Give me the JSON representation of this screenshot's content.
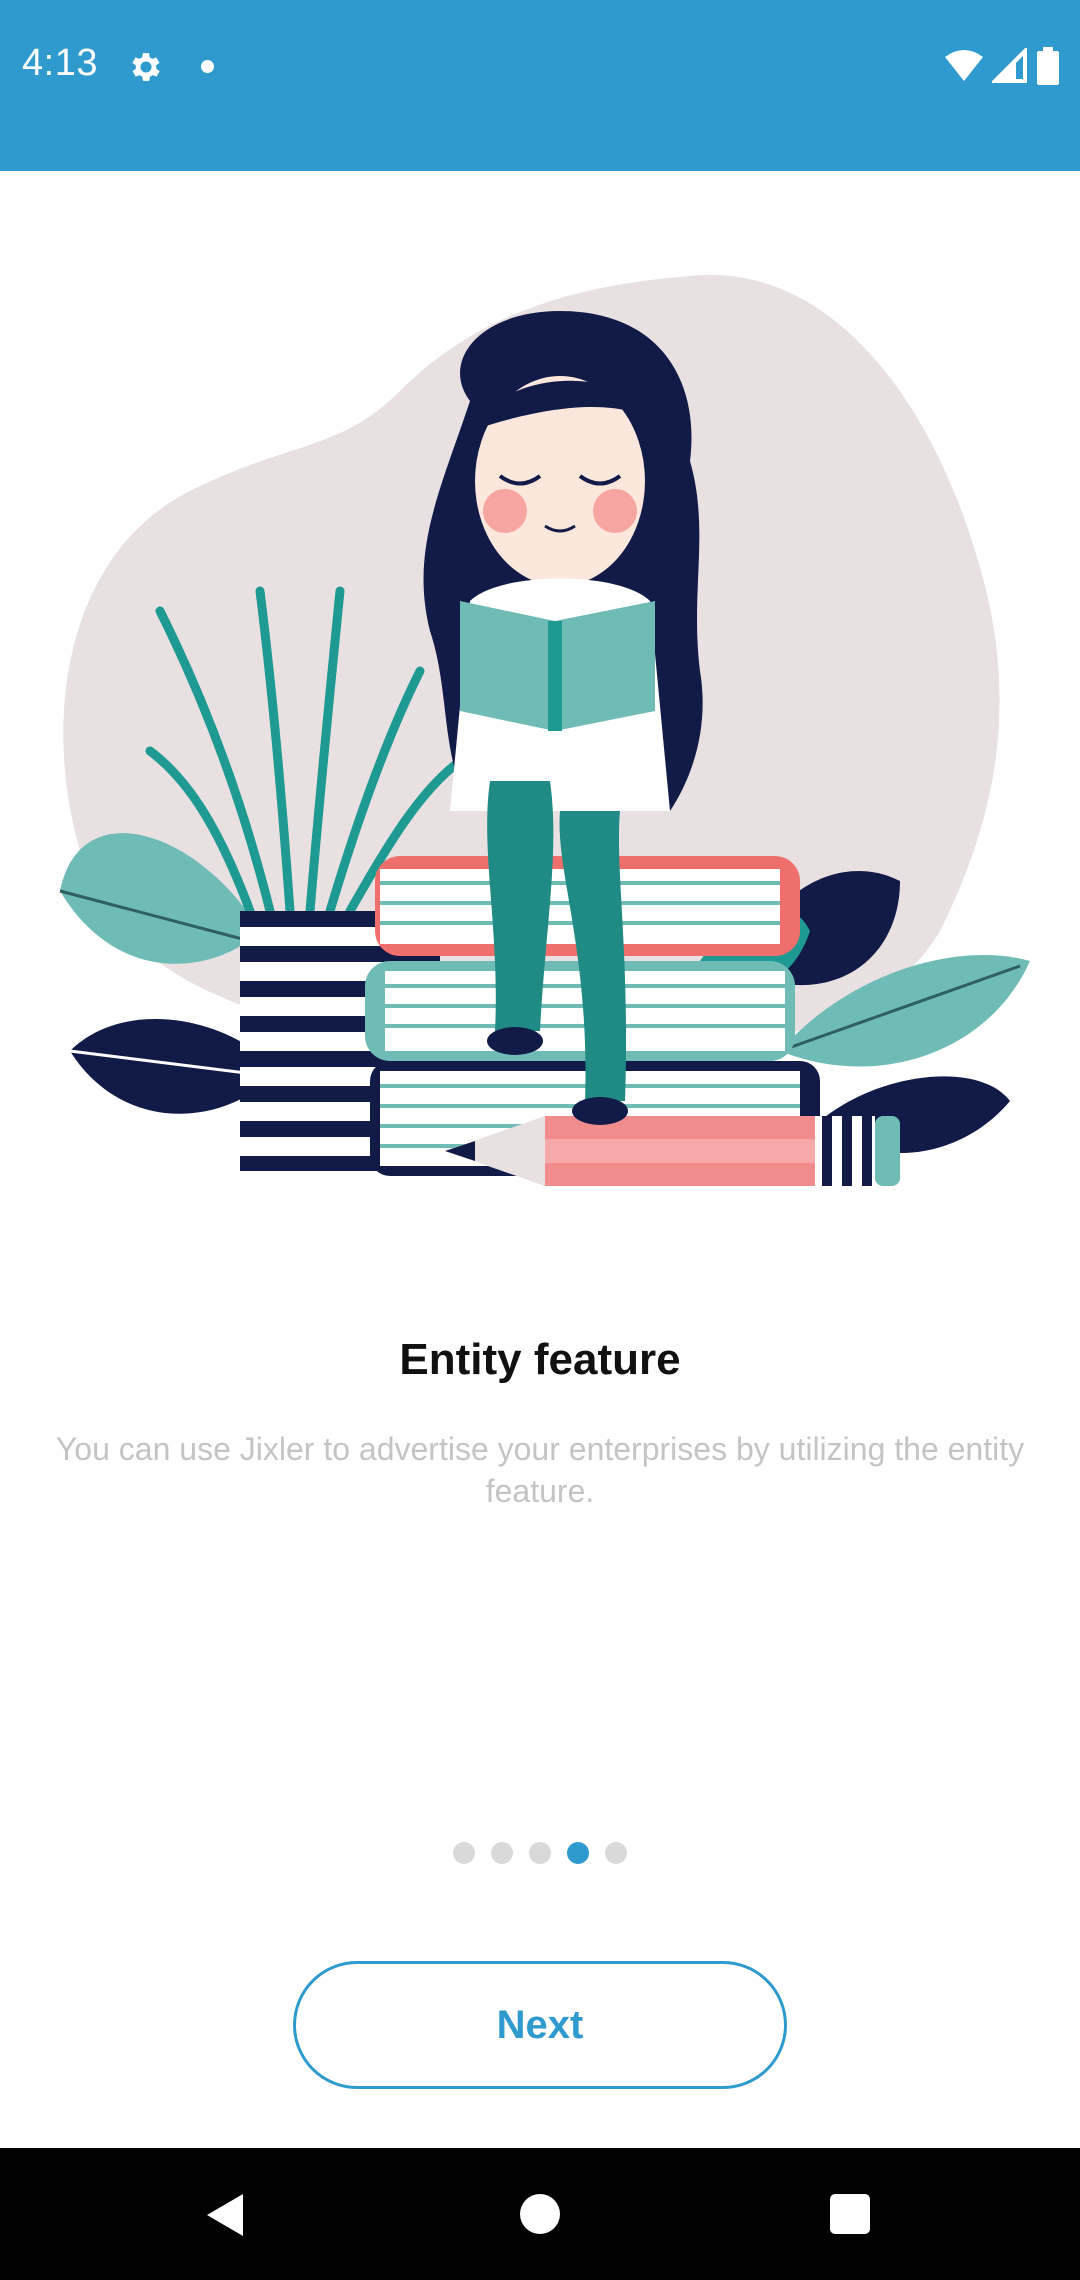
{
  "status_bar": {
    "time": "4:13",
    "icons": [
      "gear-icon",
      "notification-dot-icon",
      "wifi-icon",
      "cellular-signal-icon",
      "battery-icon"
    ],
    "background_color": "#2f9ace"
  },
  "illustration": {
    "icon": "woman-reading-on-books-illustration"
  },
  "onboarding": {
    "title": "Entity feature",
    "description": "You can use Jixler to advertise your enterprises by utilizing the entity feature."
  },
  "pager": {
    "total_pages": 5,
    "active_page": 4,
    "active_color": "#2f9ace",
    "inactive_color": "#d9d9d9"
  },
  "next_button": {
    "label": "Next",
    "color": "#2f9ace"
  },
  "nav_bar": {
    "icons": [
      "back-icon",
      "home-icon",
      "recents-icon"
    ]
  }
}
